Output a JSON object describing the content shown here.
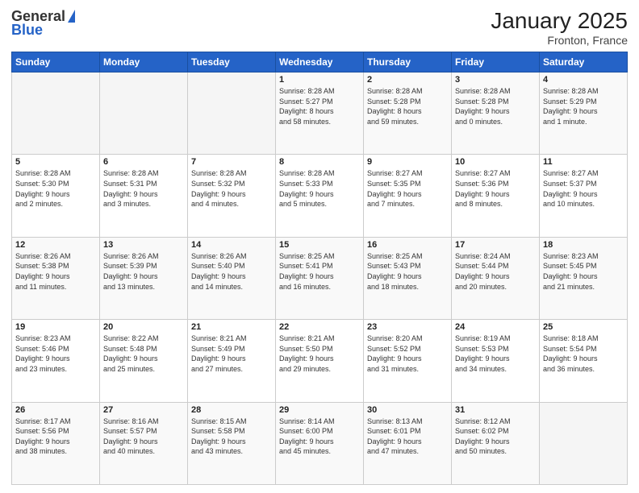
{
  "header": {
    "logo_general": "General",
    "logo_blue": "Blue",
    "month_title": "January 2025",
    "location": "Fronton, France"
  },
  "days_of_week": [
    "Sunday",
    "Monday",
    "Tuesday",
    "Wednesday",
    "Thursday",
    "Friday",
    "Saturday"
  ],
  "weeks": [
    [
      {
        "day": "",
        "text": ""
      },
      {
        "day": "",
        "text": ""
      },
      {
        "day": "",
        "text": ""
      },
      {
        "day": "1",
        "text": "Sunrise: 8:28 AM\nSunset: 5:27 PM\nDaylight: 8 hours\nand 58 minutes."
      },
      {
        "day": "2",
        "text": "Sunrise: 8:28 AM\nSunset: 5:28 PM\nDaylight: 8 hours\nand 59 minutes."
      },
      {
        "day": "3",
        "text": "Sunrise: 8:28 AM\nSunset: 5:28 PM\nDaylight: 9 hours\nand 0 minutes."
      },
      {
        "day": "4",
        "text": "Sunrise: 8:28 AM\nSunset: 5:29 PM\nDaylight: 9 hours\nand 1 minute."
      }
    ],
    [
      {
        "day": "5",
        "text": "Sunrise: 8:28 AM\nSunset: 5:30 PM\nDaylight: 9 hours\nand 2 minutes."
      },
      {
        "day": "6",
        "text": "Sunrise: 8:28 AM\nSunset: 5:31 PM\nDaylight: 9 hours\nand 3 minutes."
      },
      {
        "day": "7",
        "text": "Sunrise: 8:28 AM\nSunset: 5:32 PM\nDaylight: 9 hours\nand 4 minutes."
      },
      {
        "day": "8",
        "text": "Sunrise: 8:28 AM\nSunset: 5:33 PM\nDaylight: 9 hours\nand 5 minutes."
      },
      {
        "day": "9",
        "text": "Sunrise: 8:27 AM\nSunset: 5:35 PM\nDaylight: 9 hours\nand 7 minutes."
      },
      {
        "day": "10",
        "text": "Sunrise: 8:27 AM\nSunset: 5:36 PM\nDaylight: 9 hours\nand 8 minutes."
      },
      {
        "day": "11",
        "text": "Sunrise: 8:27 AM\nSunset: 5:37 PM\nDaylight: 9 hours\nand 10 minutes."
      }
    ],
    [
      {
        "day": "12",
        "text": "Sunrise: 8:26 AM\nSunset: 5:38 PM\nDaylight: 9 hours\nand 11 minutes."
      },
      {
        "day": "13",
        "text": "Sunrise: 8:26 AM\nSunset: 5:39 PM\nDaylight: 9 hours\nand 13 minutes."
      },
      {
        "day": "14",
        "text": "Sunrise: 8:26 AM\nSunset: 5:40 PM\nDaylight: 9 hours\nand 14 minutes."
      },
      {
        "day": "15",
        "text": "Sunrise: 8:25 AM\nSunset: 5:41 PM\nDaylight: 9 hours\nand 16 minutes."
      },
      {
        "day": "16",
        "text": "Sunrise: 8:25 AM\nSunset: 5:43 PM\nDaylight: 9 hours\nand 18 minutes."
      },
      {
        "day": "17",
        "text": "Sunrise: 8:24 AM\nSunset: 5:44 PM\nDaylight: 9 hours\nand 20 minutes."
      },
      {
        "day": "18",
        "text": "Sunrise: 8:23 AM\nSunset: 5:45 PM\nDaylight: 9 hours\nand 21 minutes."
      }
    ],
    [
      {
        "day": "19",
        "text": "Sunrise: 8:23 AM\nSunset: 5:46 PM\nDaylight: 9 hours\nand 23 minutes."
      },
      {
        "day": "20",
        "text": "Sunrise: 8:22 AM\nSunset: 5:48 PM\nDaylight: 9 hours\nand 25 minutes."
      },
      {
        "day": "21",
        "text": "Sunrise: 8:21 AM\nSunset: 5:49 PM\nDaylight: 9 hours\nand 27 minutes."
      },
      {
        "day": "22",
        "text": "Sunrise: 8:21 AM\nSunset: 5:50 PM\nDaylight: 9 hours\nand 29 minutes."
      },
      {
        "day": "23",
        "text": "Sunrise: 8:20 AM\nSunset: 5:52 PM\nDaylight: 9 hours\nand 31 minutes."
      },
      {
        "day": "24",
        "text": "Sunrise: 8:19 AM\nSunset: 5:53 PM\nDaylight: 9 hours\nand 34 minutes."
      },
      {
        "day": "25",
        "text": "Sunrise: 8:18 AM\nSunset: 5:54 PM\nDaylight: 9 hours\nand 36 minutes."
      }
    ],
    [
      {
        "day": "26",
        "text": "Sunrise: 8:17 AM\nSunset: 5:56 PM\nDaylight: 9 hours\nand 38 minutes."
      },
      {
        "day": "27",
        "text": "Sunrise: 8:16 AM\nSunset: 5:57 PM\nDaylight: 9 hours\nand 40 minutes."
      },
      {
        "day": "28",
        "text": "Sunrise: 8:15 AM\nSunset: 5:58 PM\nDaylight: 9 hours\nand 43 minutes."
      },
      {
        "day": "29",
        "text": "Sunrise: 8:14 AM\nSunset: 6:00 PM\nDaylight: 9 hours\nand 45 minutes."
      },
      {
        "day": "30",
        "text": "Sunrise: 8:13 AM\nSunset: 6:01 PM\nDaylight: 9 hours\nand 47 minutes."
      },
      {
        "day": "31",
        "text": "Sunrise: 8:12 AM\nSunset: 6:02 PM\nDaylight: 9 hours\nand 50 minutes."
      },
      {
        "day": "",
        "text": ""
      }
    ]
  ]
}
